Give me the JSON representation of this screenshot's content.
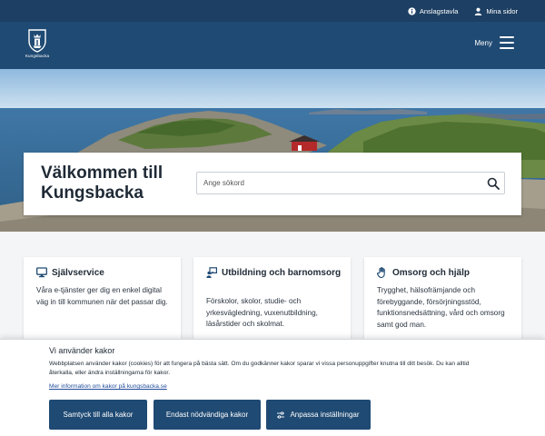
{
  "topbar": {
    "links": [
      {
        "label": "Anslagstavla",
        "icon": "info-icon"
      },
      {
        "label": "Mina sidor",
        "icon": "user-icon"
      }
    ]
  },
  "header": {
    "logo_text": "Kungsbacka",
    "menu_label": "Meny"
  },
  "hero": {
    "title": "Välkommen till Kungsbacka",
    "search_placeholder": "Ange sökord",
    "search_value": ""
  },
  "cards": [
    {
      "icon": "monitor-icon",
      "title": "Självservice",
      "text": "Våra e-tjänster ger dig en enkel digital väg in till kommunen när det passar dig."
    },
    {
      "icon": "education-icon",
      "title": "Utbildning och barn­omsorg",
      "text": "Förskolor, skolor, studie- och yrkesvägledning, vuxenutbildning, läsårstider och skolmat."
    },
    {
      "icon": "hand-icon",
      "title": "Omsorg och hjälp",
      "text": "Trygghet, hälsofrämjande och förebyggande, försörjningsstöd, funktionsnedsättning, vård och omsorg samt god man."
    }
  ],
  "cookie": {
    "title": "Vi använder kakor",
    "text": "Webbplatsen använder kakor (cookies) för att fungera på bästa sätt. Om du godkänner kakor sparar vi vissa personuppgifter knutna till ditt besök. Du kan alltid återkalla, eller ändra inställningarna för kakor.",
    "link": "Mer information om kakor på kungsbacka.se",
    "buttons": {
      "accept_all": "Samtyck till alla kakor",
      "necessary_only": "Endast nödvändiga kakor",
      "customize": "Anpassa inställningar"
    }
  },
  "colors": {
    "topbar": "#1d3f63",
    "header": "#1f4a73",
    "button": "#1f4a73",
    "link": "#1f4a9a"
  }
}
